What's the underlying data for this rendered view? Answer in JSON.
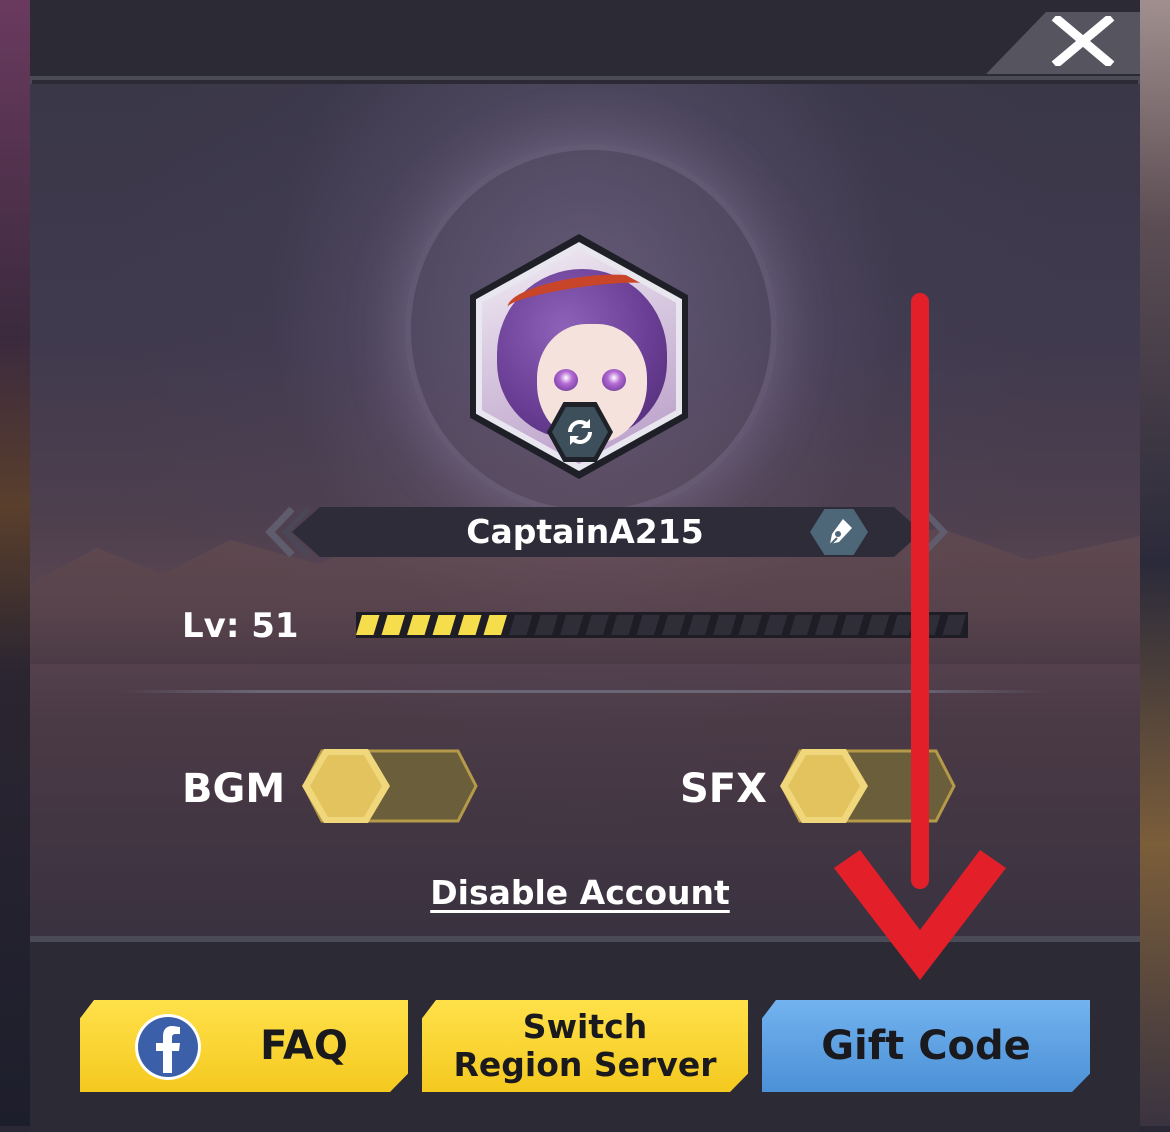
{
  "profile": {
    "player_name": "CaptainA215",
    "level_label": "Lv: 51",
    "xp_progress": 0.26
  },
  "settings": {
    "bgm_label": "BGM",
    "sfx_label": "SFX"
  },
  "account": {
    "disable_label": "Disable Account"
  },
  "buttons": {
    "faq_label": "FAQ",
    "switch_region_line1": "Switch",
    "switch_region_line2": "Region Server",
    "gift_code_label": "Gift Code"
  },
  "colors": {
    "accent_yellow": "#f4c91f",
    "accent_blue": "#4c90d6",
    "annotation_red": "#e3202a"
  },
  "icons": [
    "close-icon",
    "refresh-icon",
    "edit-pen-icon",
    "facebook-icon",
    "red-arrow-annotation"
  ]
}
